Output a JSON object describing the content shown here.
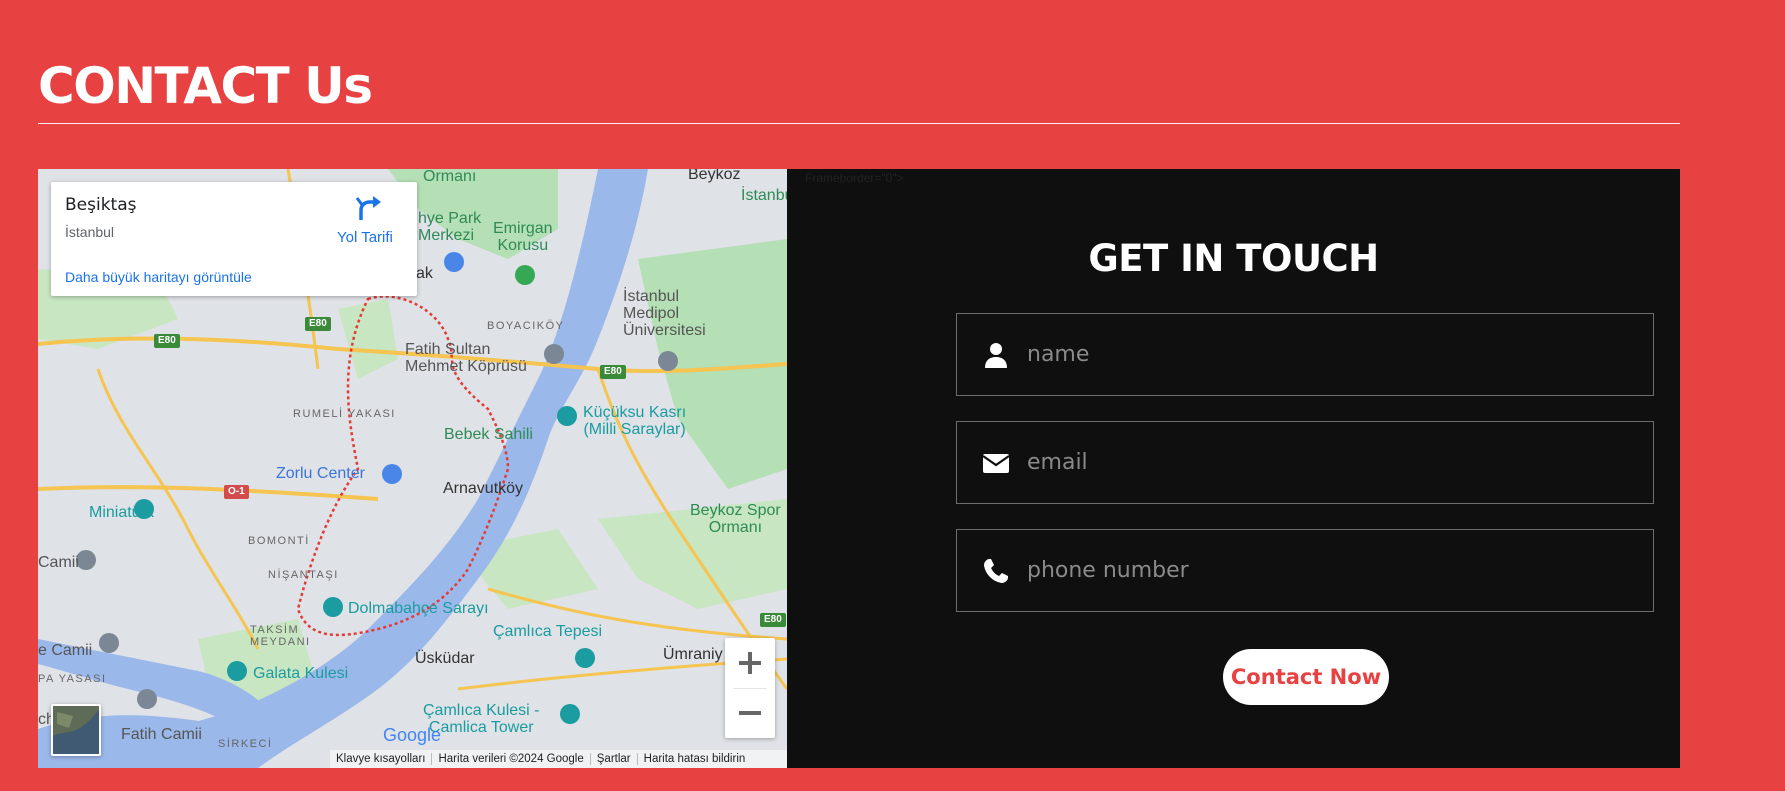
{
  "page": {
    "title": "CONTACT Us"
  },
  "map": {
    "info_card": {
      "place": "Beşiktaş",
      "city": "İstanbul",
      "directions_label": "Yol Tarifi",
      "larger_map_label": "Daha büyük haritayı görüntüle"
    },
    "labels": {
      "ormani_top": "Ormanı",
      "beykoz": "Beykoz",
      "istanbul_ke": "İstanbul Ke",
      "hye_park": "hye Park\nMerkezi",
      "emirgan": "Emirgan\nKorusu",
      "ak": "ak",
      "istanbul_medipol": "İstanbul\nMedipol\nÜniversitesi",
      "boyacikoy": "BOYACIKÖY",
      "fatih_sultan": "Fatih Sultan\nMehmet Köprüsü",
      "rumeli": "RUMELİ YAKASI",
      "kucuksu": "Küçüksu Kasrı\n(Milli Saraylar)",
      "bebek": "Bebek Sahili",
      "zorlu": "Zorlu Center",
      "arnavutkoy": "Arnavutköy",
      "miniaturk": "Miniatürk",
      "beykoz_spor": "Beykoz Spor\nOrmanı",
      "bomonti": "BOMONTİ",
      "camii_left": "Camii",
      "nisantasi": "NİŞANTAŞI",
      "dolmabahce": "Dolmabahçe Sarayı",
      "camlica_tepesi": "Çamlıca Tepesi",
      "taksim": "TAKSİM\nMEYDANI",
      "e_camii": "e Camii",
      "uskudar": "Üsküdar",
      "umraniye": "Ümraniy",
      "pa_yasasi": "PA YASASI",
      "galata": "Galata Kulesi",
      "camlica_kulesi": "Çamlıca Kulesi -\nCamlica Tower",
      "ch": "ch",
      "fatih_camii": "Fatih Camii",
      "sirkeci": "SİRKECİ"
    },
    "road_shields": [
      "E80",
      "E80",
      "E80",
      "O-1",
      "E80"
    ],
    "google_logo": "Google",
    "attribution": [
      "Klavye kısayolları",
      "Harita verileri ©2024 Google",
      "Şartlar",
      "Harita hatası bildirin"
    ],
    "zoom_in": "+",
    "zoom_out": "−"
  },
  "form": {
    "iframe_leak_text": "Frameborder=\"0\">",
    "heading": "GET IN TOUCH",
    "fields": [
      {
        "icon": "user-icon",
        "placeholder": "name",
        "value": ""
      },
      {
        "icon": "envelope-icon",
        "placeholder": "email",
        "value": ""
      },
      {
        "icon": "phone-icon",
        "placeholder": "phone number",
        "value": ""
      }
    ],
    "submit_label": "Contact Now"
  },
  "colors": {
    "background": "#E84142",
    "panel": "#0f0f0f",
    "accent": "#E84142",
    "map_water": "#9bb8ea",
    "map_land": "#dfe2e6",
    "map_park": "#b5dfb5"
  }
}
